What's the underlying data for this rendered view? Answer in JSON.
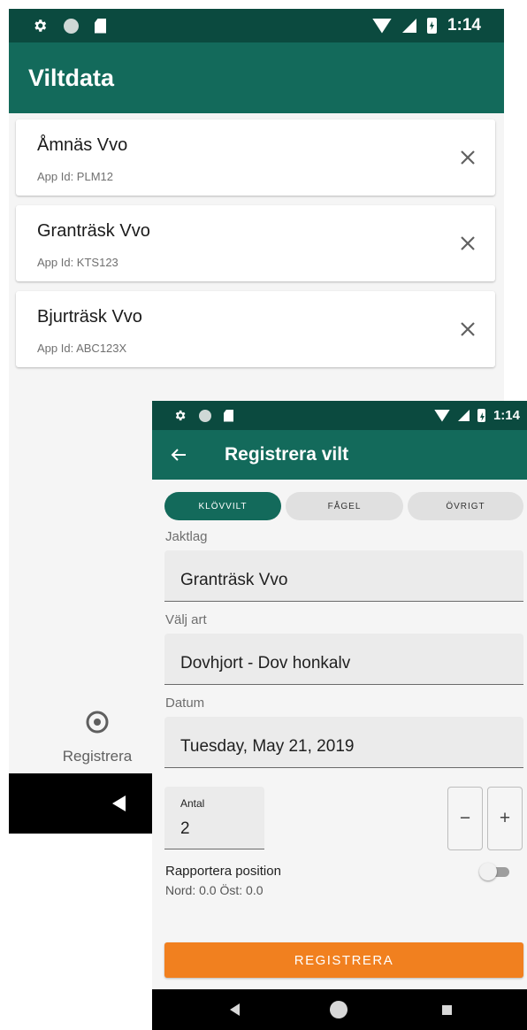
{
  "theme": {
    "status_bar": "#0b4a3f",
    "app_bar": "#136a5b",
    "accent": "#f1801f",
    "background": "#f5f5f5"
  },
  "back_screen": {
    "status_bar": {
      "left_icons": [
        "settings-icon",
        "sync-icon",
        "sd-card-icon"
      ],
      "right_icons": [
        "wifi-icon",
        "signal-icon",
        "battery-charging-icon"
      ],
      "time": "1:14"
    },
    "title": "Viltdata",
    "items": [
      {
        "name": "Åmnäs Vvo",
        "app_id": "App Id: PLM12"
      },
      {
        "name": "Granträsk Vvo",
        "app_id": "App Id: KTS123"
      },
      {
        "name": "Bjurträsk Vvo",
        "app_id": "App Id: ABC123X"
      }
    ],
    "bottom_nav": {
      "register_label": "Registrera",
      "register_icon": "location-pin-icon"
    }
  },
  "front_screen": {
    "status_bar": {
      "left_icons": [
        "settings-icon",
        "sync-icon",
        "sd-card-icon"
      ],
      "right_icons": [
        "wifi-icon",
        "signal-icon",
        "battery-charging-icon"
      ],
      "time": "1:14"
    },
    "title": "Registrera vilt",
    "segments": [
      {
        "label": "KLÖVVILT",
        "active": true
      },
      {
        "label": "FÅGEL",
        "active": false
      },
      {
        "label": "ÖVRIGT",
        "active": false
      }
    ],
    "fields": {
      "jaktlag": {
        "label": "Jaktlag",
        "value": "Granträsk Vvo"
      },
      "art": {
        "label": "Välj art",
        "value": "Dovhjort - Dov honkalv"
      },
      "datum": {
        "label": "Datum",
        "value": "Tuesday, May 21, 2019"
      }
    },
    "quantity": {
      "label": "Antal",
      "value": "2",
      "decrement": "−",
      "increment": "+"
    },
    "position": {
      "label": "Rapportera position",
      "coords": "Nord: 0.0 Öst: 0.0",
      "enabled": false
    },
    "submit_label": "REGISTRERA"
  }
}
